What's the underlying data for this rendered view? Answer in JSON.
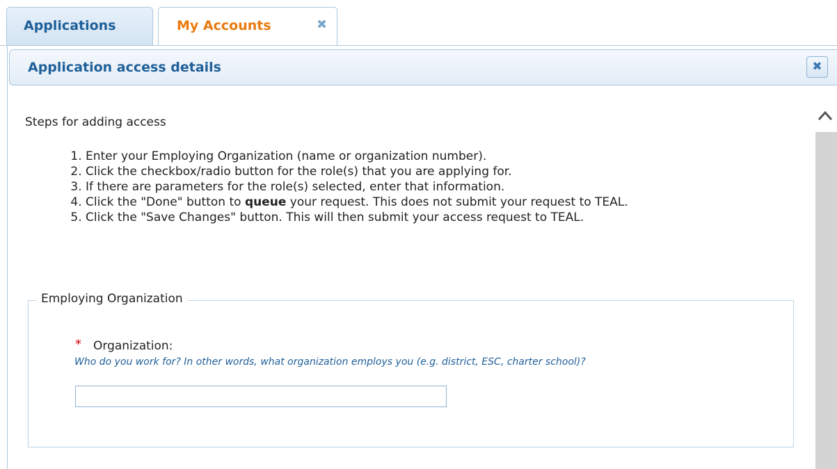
{
  "tabs": [
    {
      "label": "Applications",
      "active": false
    },
    {
      "label": "My Accounts",
      "active": true,
      "close_icon": "close-icon"
    }
  ],
  "panel": {
    "title": "Application access details",
    "close_icon": "close-icon"
  },
  "content": {
    "intro": "Steps for adding access",
    "steps": [
      {
        "text": "Enter your Employing Organization (name or organization number)."
      },
      {
        "text": "Click the checkbox/radio button for the role(s) that you are applying for."
      },
      {
        "text": "If there are parameters for the role(s) selected, enter that information."
      },
      {
        "before": "Click the \"Done\" button to ",
        "bold": "queue",
        "after": " your request. This does not submit your request to TEAL."
      },
      {
        "text": "Click the \"Save Changes\" button. This will then submit your access request to TEAL."
      }
    ]
  },
  "employing_org": {
    "legend": "Employing Organization",
    "required_mark": "*",
    "label": "Organization:",
    "help": "Who do you work for? In other words, what organization employs you (e.g. district, ESC, charter school)?",
    "value": ""
  },
  "colors": {
    "active_tab_text": "#e87a10",
    "tab_text": "#1f5f99",
    "help_text": "#1f5f99",
    "required": "#d40000",
    "border": "#aac8e0"
  }
}
